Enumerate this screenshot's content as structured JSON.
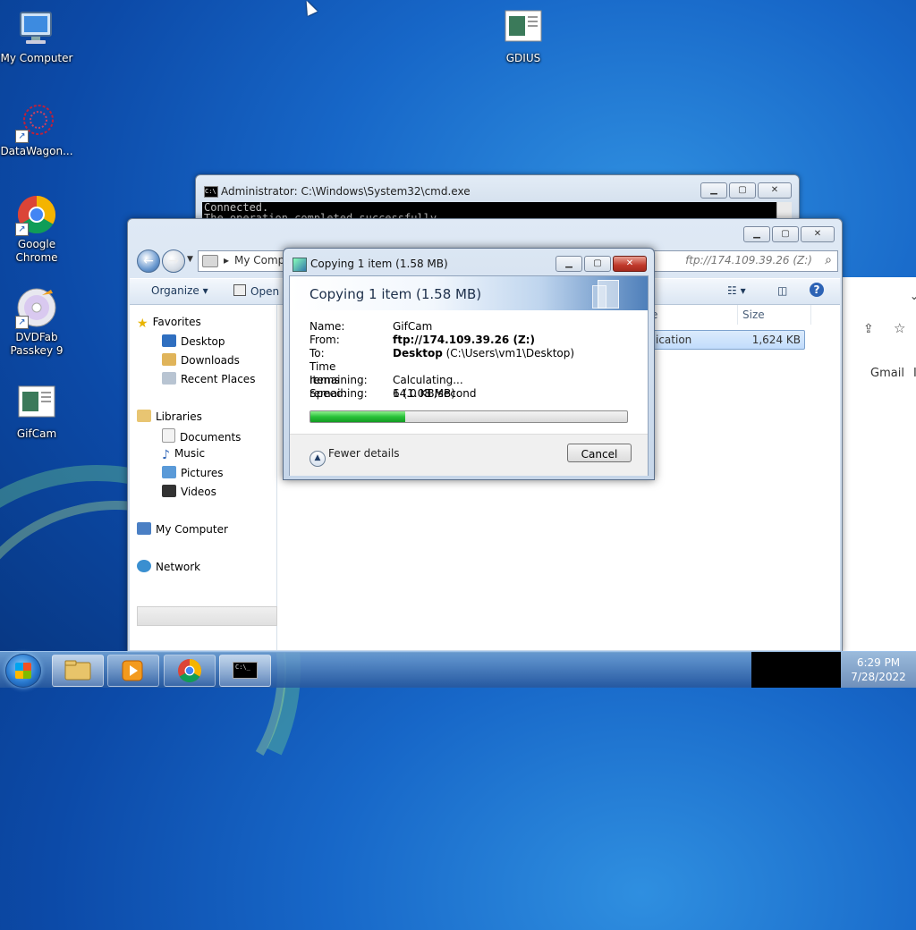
{
  "desktop": {
    "icons": [
      {
        "label": "My Computer"
      },
      {
        "label": "DataWagon..."
      },
      {
        "label": "Google Chrome"
      },
      {
        "label": "DVDFab Passkey 9"
      },
      {
        "label": "GifCam"
      },
      {
        "label": "GDIUS"
      }
    ]
  },
  "cmd": {
    "title": "Administrator: C:\\Windows\\System32\\cmd.exe",
    "icon_text": "C:\\",
    "lines": [
      "Connected.",
      "The operation completed successfully."
    ]
  },
  "explorer": {
    "breadcrumb": "My Compu",
    "search_path": "ftp://174.109.39.26 (Z:)",
    "toolbar": {
      "organize": "Organize",
      "open": "Open"
    },
    "nav": {
      "favorites": "Favorites",
      "desktop": "Desktop",
      "downloads": "Downloads",
      "recent_places": "Recent Places",
      "libraries": "Libraries",
      "documents": "Documents",
      "music": "Music",
      "pictures": "Pictures",
      "videos": "Videos",
      "my_computer": "My Computer",
      "network": "Network"
    },
    "columns": {
      "type_partial": "e",
      "size": "Size"
    },
    "file": {
      "type_partial": "ication",
      "size": "1,624 KB"
    }
  },
  "browser": {
    "gmail": "Gmail",
    "partial": "I"
  },
  "copy_dialog": {
    "title": "Copying 1 item (1.58 MB)",
    "heading": "Copying 1 item (1.58 MB)",
    "name_label": "Name:",
    "name_value": "GifCam",
    "from_label": "From:",
    "from_value": "ftp://174.109.39.26 (Z:)",
    "to_label": "To:",
    "to_bold": "Desktop",
    "to_rest": "(C:\\Users\\vm1\\Desktop)",
    "time_label": "Time remaining:",
    "time_value": "Calculating...",
    "items_label": "Items remaining:",
    "items_value": "1 (1.08 MB)",
    "speed_label": "Speed:",
    "speed_value": "64.0 KB/second",
    "progress_percent": 30,
    "fewer_details": "Fewer details",
    "cancel": "Cancel"
  },
  "taskbar": {
    "time": "6:29 PM",
    "date": "7/28/2022",
    "cmd_icon_text": "C:\\_"
  }
}
